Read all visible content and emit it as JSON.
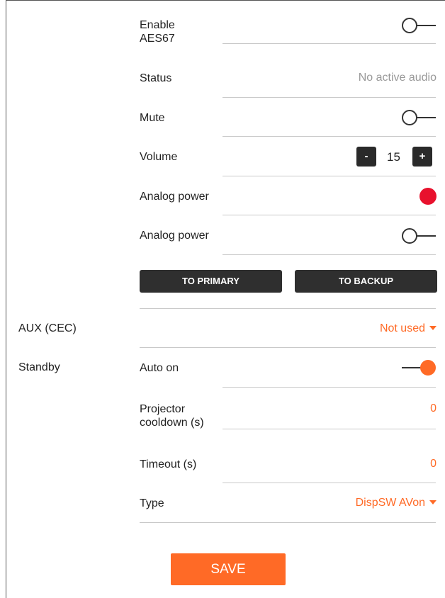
{
  "rows": {
    "enable_aes67": {
      "label": "Enable\nAES67",
      "state": "off"
    },
    "status": {
      "label": "Status",
      "value": "No active audio"
    },
    "mute": {
      "label": "Mute",
      "state": "off"
    },
    "volume": {
      "label": "Volume",
      "value": "15",
      "minus": "-",
      "plus": "+"
    },
    "analog_power_1": {
      "label": "Analog power",
      "indicator_color": "#e8112d"
    },
    "analog_power_2": {
      "label": "Analog power",
      "state": "off"
    }
  },
  "buttons": {
    "to_primary": "TO PRIMARY",
    "to_backup": "TO BACKUP",
    "save": "SAVE"
  },
  "aux": {
    "section_label": "AUX (CEC)",
    "value": "Not used"
  },
  "standby": {
    "section_label": "Standby",
    "auto_on": {
      "label": "Auto on",
      "state": "on"
    },
    "projector_cooldown": {
      "label": "Projector\ncooldown (s)",
      "value": "0"
    },
    "timeout": {
      "label": "Timeout (s)",
      "value": "0"
    },
    "type": {
      "label": "Type",
      "value": "DispSW AVon"
    }
  },
  "colors": {
    "accent": "#ff6a26",
    "dark": "#2f2f2f",
    "alert": "#e8112d"
  }
}
